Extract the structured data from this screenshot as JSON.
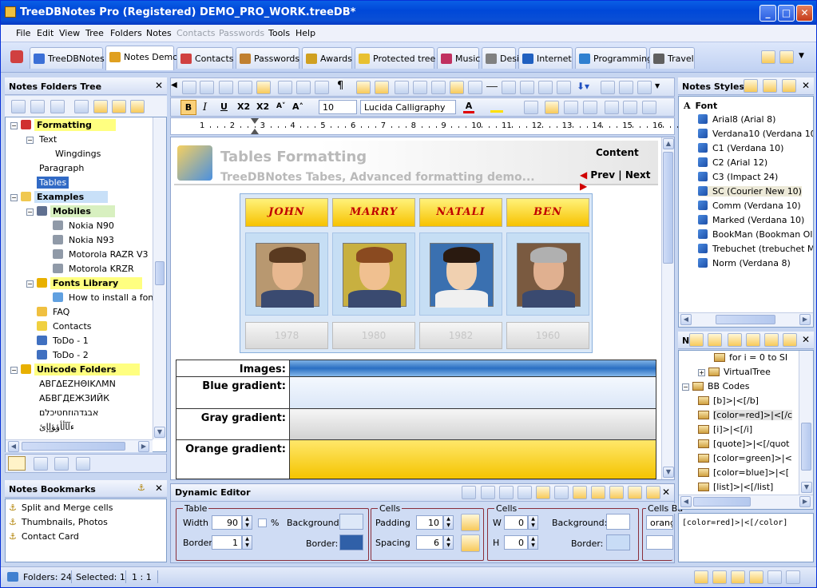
{
  "window": {
    "title": "TreeDBNotes Pro (Registered) DEMO_PRO_WORK.treeDB*",
    "minimize": "_",
    "maximize": "□",
    "close": "✕"
  },
  "menu": {
    "file": "File",
    "edit": "Edit",
    "view": "View",
    "tree": "Tree",
    "folders": "Folders",
    "notes": "Notes",
    "contacts": "Contacts",
    "passwords": "Passwords",
    "tools": "Tools",
    "help": "Help"
  },
  "tabs": [
    {
      "label": "TreeDBNotes",
      "color": "#3b6fd6"
    },
    {
      "label": "Notes Demo",
      "color": "#e0a020"
    },
    {
      "label": "Contacts",
      "color": "#d04040"
    },
    {
      "label": "Passwords",
      "color": "#c08030"
    },
    {
      "label": "Awards",
      "color": "#d0a020"
    },
    {
      "label": "Protected tree",
      "color": "#e8c030"
    },
    {
      "label": "Music",
      "color": "#c03060"
    },
    {
      "label": "Design",
      "color": "#808080"
    },
    {
      "label": "Internet",
      "color": "#2060c0"
    },
    {
      "label": "Programming",
      "color": "#3080d0"
    },
    {
      "label": "Travel",
      "color": "#606060"
    }
  ],
  "folders_panel": {
    "title": "Notes Folders Tree",
    "close": "✕",
    "tree": [
      {
        "label": "Formatting",
        "level": 0,
        "toggle": "−",
        "hl": "hl-y",
        "bold": true,
        "icon": "#d03030"
      },
      {
        "label": "Text",
        "level": 1,
        "toggle": "−",
        "hl": "",
        "bold": false,
        "icon": ""
      },
      {
        "label": "Wingdings",
        "level": 2,
        "toggle": "",
        "hl": "",
        "bold": false,
        "icon": ""
      },
      {
        "label": "Paragraph",
        "level": 1,
        "toggle": "",
        "hl": "",
        "bold": false,
        "icon": ""
      },
      {
        "label": "Tables",
        "level": 1,
        "toggle": "",
        "hl": "sel",
        "bold": false,
        "icon": ""
      },
      {
        "label": "Examples",
        "level": 0,
        "toggle": "−",
        "hl": "hl-b",
        "bold": true,
        "icon": "#f0c850"
      },
      {
        "label": "Mobiles",
        "level": 1,
        "toggle": "−",
        "hl": "hl-g",
        "bold": true,
        "icon": "#607090"
      },
      {
        "label": "Nokia N90",
        "level": 2,
        "toggle": "",
        "hl": "",
        "bold": false,
        "icon": "#909aa8"
      },
      {
        "label": "Nokia N93",
        "level": 2,
        "toggle": "",
        "hl": "",
        "bold": false,
        "icon": "#909aa8"
      },
      {
        "label": "Motorola RAZR V3",
        "level": 2,
        "toggle": "",
        "hl": "",
        "bold": false,
        "icon": "#909aa8"
      },
      {
        "label": "Motorola KRZR",
        "level": 2,
        "toggle": "",
        "hl": "",
        "bold": false,
        "icon": "#909aa8"
      },
      {
        "label": "Fonts Library",
        "level": 1,
        "toggle": "−",
        "hl": "hl-y",
        "bold": true,
        "icon": "#e8b000"
      },
      {
        "label": "How to install a font",
        "level": 2,
        "toggle": "",
        "hl": "",
        "bold": false,
        "icon": "#60a0e0"
      },
      {
        "label": "FAQ",
        "level": 1,
        "toggle": "",
        "hl": "",
        "bold": false,
        "icon": "#f0c040"
      },
      {
        "label": "Contacts",
        "level": 1,
        "toggle": "",
        "hl": "",
        "bold": false,
        "icon": "#f0d040"
      },
      {
        "label": "ToDo - 1",
        "level": 1,
        "toggle": "",
        "hl": "",
        "bold": false,
        "icon": "#4070c0"
      },
      {
        "label": "ToDo - 2",
        "level": 1,
        "toggle": "",
        "hl": "",
        "bold": false,
        "icon": "#4070c0"
      },
      {
        "label": "Unicode Folders",
        "level": 0,
        "toggle": "−",
        "hl": "hl-y",
        "bold": true,
        "icon": "#e8b000"
      },
      {
        "label": "ΑΒΓΔΕΖΗΘΙΚΛΜΝ",
        "level": 1,
        "toggle": "",
        "hl": "",
        "bold": false,
        "icon": ""
      },
      {
        "label": "АБВГДЕЖЗИЙК",
        "level": 1,
        "toggle": "",
        "hl": "",
        "bold": false,
        "icon": ""
      },
      {
        "label": "אבגדהוזחטיכלם",
        "level": 1,
        "toggle": "",
        "hl": "",
        "bold": false,
        "icon": ""
      },
      {
        "label": "ﺀﺁﺂﺃﺄﺅﺆﺇﺈﺉ",
        "level": 1,
        "toggle": "",
        "hl": "",
        "bold": false,
        "icon": ""
      }
    ]
  },
  "bookmarks_panel": {
    "title": "Notes Bookmarks",
    "close": "✕",
    "items": [
      "Split and Merge cells",
      "Thumbnails, Photos",
      "Contact Card"
    ]
  },
  "format_bar": {
    "bold": "B",
    "italic": "I",
    "underline": "U",
    "subscript": "X2",
    "superscript": "X2",
    "font_size": "10",
    "font_name": "Lucida Calligraphy",
    "font_color": "A"
  },
  "ruler": {
    "marks": [
      "1",
      "2",
      "3",
      "4",
      "5",
      "6",
      "7",
      "8",
      "9",
      "10",
      "11",
      "12",
      "13",
      "14",
      "15",
      "16"
    ]
  },
  "document": {
    "title": "Tables Formatting",
    "subtitle": "TreeDBNotes Tabes, Advanced formatting demo...",
    "content_link": "Content",
    "prev": "Prev",
    "separator": "|",
    "next": "Next",
    "people": [
      {
        "name": "JOHN",
        "year": "1978",
        "skin": "#e8b890",
        "hair": "#5a3a20",
        "bg": "#b89870"
      },
      {
        "name": "MARRY",
        "year": "1980",
        "skin": "#f0c090",
        "hair": "#8a4a20",
        "bg": "#c8b040"
      },
      {
        "name": "NATALI",
        "year": "1982",
        "skin": "#f0d0b0",
        "hair": "#2a1a10",
        "bg": "#3a70b0"
      },
      {
        "name": "BEN",
        "year": "1960",
        "skin": "#e0b090",
        "hair": "#b0b0b0",
        "bg": "#7a5a40"
      }
    ],
    "gradients": [
      {
        "label": "Images:",
        "fill": "linear-gradient(#7fb2e6,#2a6fc2 50%,#86b8ea)"
      },
      {
        "label": "Blue gradient:",
        "fill": "linear-gradient(#f4f8fe,#dbe7f8)"
      },
      {
        "label": "Gray gradient:",
        "fill": "linear-gradient(#f6f6f6,#d2d2d2)"
      },
      {
        "label": "Orange gradient:",
        "fill": "linear-gradient(#ffe76a,#f4c400)"
      }
    ]
  },
  "dynamic_editor": {
    "title": "Dynamic Editor",
    "close": "✕",
    "table_group": "Table",
    "width_label": "Width",
    "width_value": "90",
    "percent_label": "%",
    "background_label": "Background:",
    "border_label": "Border",
    "border_value": "1",
    "border_color_label": "Border:",
    "cells_group": "Cells",
    "padding_label": "Padding",
    "padding_value": "10",
    "spacing_label": "Spacing",
    "spacing_value": "6",
    "cells2_group": "Cells",
    "w_label": "W",
    "w_value": "0",
    "h_label": "H",
    "h_value": "0",
    "cell_bg_label": "Background:",
    "cell_border_label": "Border:",
    "cells_bg_group": "Cells Ba",
    "cells_bg_value": "orange"
  },
  "styles_panel": {
    "title": "Notes Styles",
    "close": "✕",
    "root": "Font",
    "items": [
      "Arial8 (Arial 8)",
      "Verdana10 (Verdana 10)",
      "C1 (Verdana 10)",
      "C2 (Arial 12)",
      "C3 (Impact 24)",
      "SC (Courier New 10)",
      "Comm (Verdana 10)",
      "Marked (Verdana 10)",
      "BookMan (Bookman Old S",
      "Trebuchet (trebuchet MS",
      "Norm (Verdana 8)"
    ]
  },
  "snippets_panel": {
    "title": "N.",
    "close": "✕",
    "items": [
      {
        "label": "for i = 0 to SI",
        "level": 2,
        "toggle": ""
      },
      {
        "label": "VirtualTree",
        "level": 1,
        "toggle": "+"
      },
      {
        "label": "BB Codes",
        "level": 0,
        "toggle": "−"
      },
      {
        "label": "[b]>|<[/b]",
        "level": 1,
        "toggle": ""
      },
      {
        "label": "[color=red]>|<[/c",
        "level": 1,
        "toggle": ""
      },
      {
        "label": "[i]>|<[/i]",
        "level": 1,
        "toggle": ""
      },
      {
        "label": "[quote]>|<[/quot",
        "level": 1,
        "toggle": ""
      },
      {
        "label": "[color=green]>|<",
        "level": 1,
        "toggle": ""
      },
      {
        "label": "[color=blue]>|<[",
        "level": 1,
        "toggle": ""
      },
      {
        "label": "[list]>|<[/list]",
        "level": 1,
        "toggle": ""
      }
    ],
    "preview": "[color=red]>|<[/color]"
  },
  "status": {
    "folders": "Folders: 24",
    "selected": "Selected: 1",
    "position": "1 : 1"
  }
}
